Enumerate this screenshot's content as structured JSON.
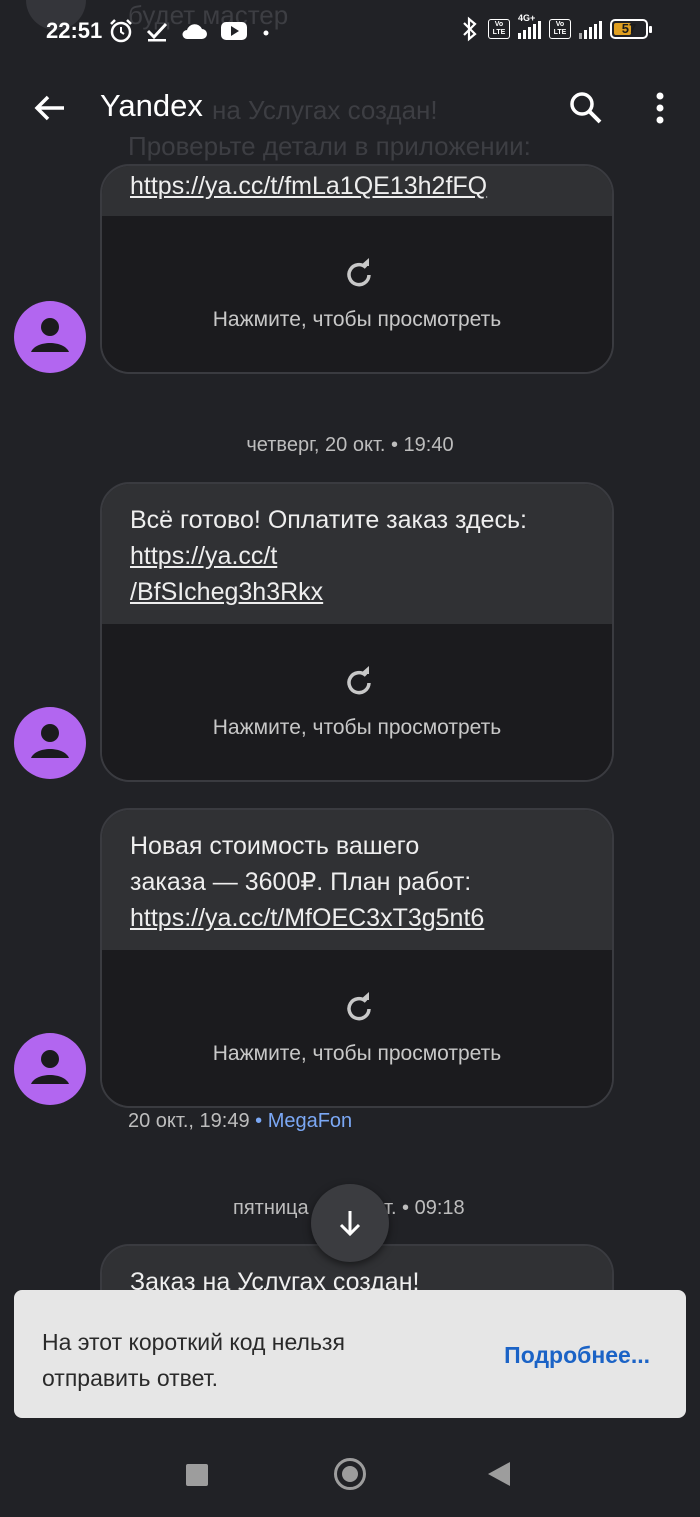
{
  "status_bar": {
    "time": "22:51",
    "battery": "57",
    "battery_level": 0.57,
    "network_tag": "4G+",
    "volte_label": "Vo LTE",
    "icons": [
      "alarm-icon",
      "check-icon",
      "cloud-icon",
      "youtube-icon",
      "dot-icon",
      "bluetooth-icon",
      "volte-icon",
      "signal-icon",
      "battery-icon"
    ]
  },
  "ghost": {
    "sender": "будет мастер",
    "line1": "на Услугах создан!",
    "line2": "Проверьте детали в приложении:"
  },
  "app_bar": {
    "title": "Yandex",
    "icons": [
      "back-arrow-icon",
      "search-icon",
      "more-vert-icon"
    ]
  },
  "messages": [
    {
      "link": "https://ya.cc/t/fmLa1QE13h2fFQ",
      "preview_label": "Нажмите, чтобы просмотреть"
    },
    {
      "date_separator": "четверг, 20 окт. • 19:40",
      "text": "Всё готово! Оплатите заказ здесь:",
      "link_part1": "https://ya.cc/t",
      "link_part2": "/BfSIcheg3h3Rkx",
      "preview_label": "Нажмите, чтобы просмотреть"
    },
    {
      "text_line1": "Новая стоимость вашего",
      "text_line2": "заказа — 3600₽. План работ:",
      "link": "https://ya.cc/t/MfOEC3xT3g5nt6",
      "preview_label": "Нажмите, чтобы просмотреть",
      "meta_time": "20 окт., 19:49",
      "meta_carrier": "MegaFon"
    },
    {
      "date_separator_left": "пятница",
      "date_separator_right": "т. • 09:18",
      "text": "Заказ на Услугах создан!"
    }
  ],
  "snackbar": {
    "message": "На этот короткий код нельзя отправить ответ.",
    "action": "Подробнее..."
  },
  "colors": {
    "background": "#212226",
    "bubble": "#303134",
    "avatar": "#b266f0",
    "link_accent": "#7ba8f5",
    "snackbar_action": "#1b63c6"
  }
}
